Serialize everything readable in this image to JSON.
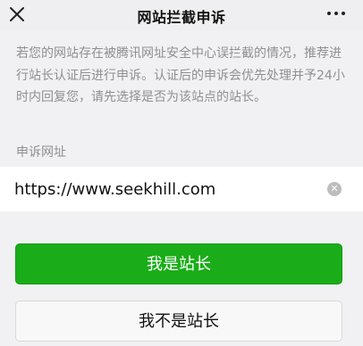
{
  "header": {
    "title": "网站拦截申诉",
    "close_icon": "close-icon",
    "more_icon": "more-icon"
  },
  "main": {
    "description": "若您的网站存在被腾讯网址安全中心误拦截的情况，推荐进行站长认证后进行申诉。认证后的申诉会优先处理并予24小时内回复您，请先选择是否为该站点的站长。",
    "field_label": "申诉网址",
    "url_value": "https://www.seekhill.com",
    "clear_icon": "clear-icon",
    "primary_button": "我是站长",
    "secondary_button": "我不是站长"
  },
  "colors": {
    "primary": "#1aad19",
    "background": "#f1f1f3",
    "muted_text": "#8f8f94"
  }
}
